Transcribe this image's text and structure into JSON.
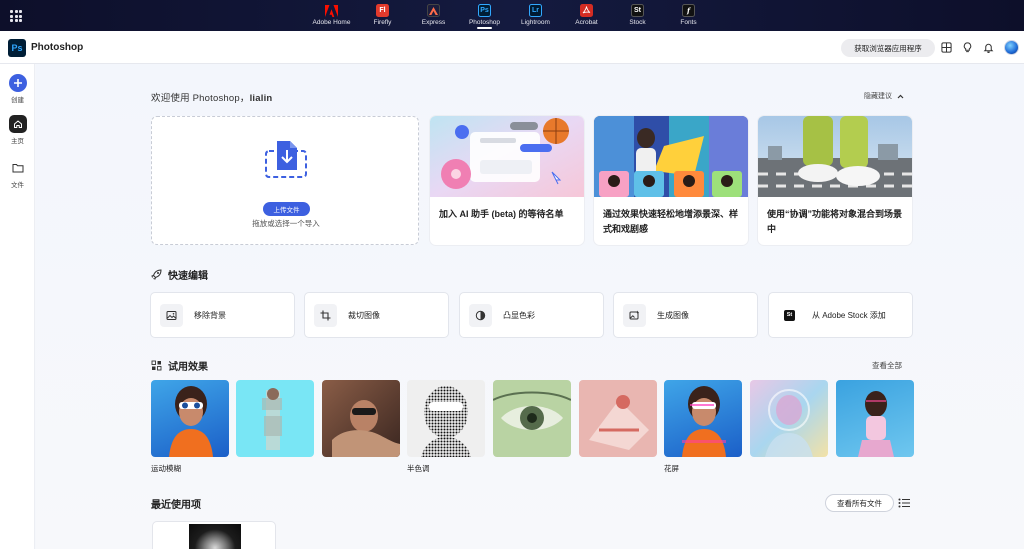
{
  "topbar": {
    "apps": [
      {
        "label": "Adobe Home",
        "logo": "A",
        "color": "#1a1a1a",
        "active": false
      },
      {
        "label": "Firefly",
        "logo": "Fl",
        "color": "#d7373f",
        "active": false
      },
      {
        "label": "Express",
        "logo": "A",
        "color": "#1b1d3a",
        "active": false
      },
      {
        "label": "Photoshop",
        "logo": "Ps",
        "color": "#001e36",
        "active": true
      },
      {
        "label": "Lightroom",
        "logo": "Lr",
        "color": "#001a33",
        "active": false
      },
      {
        "label": "Acrobat",
        "logo": "A",
        "color": "#d42c23",
        "active": false
      },
      {
        "label": "Stock",
        "logo": "St",
        "color": "#111111",
        "active": false
      },
      {
        "label": "Fonts",
        "logo": "f",
        "color": "#111111",
        "active": false
      }
    ]
  },
  "header": {
    "logo": "Ps",
    "title": "Photoshop",
    "get_app": "获取浏览器应用程序"
  },
  "rail": {
    "create": "创建",
    "home": "主页",
    "files": "文件"
  },
  "welcome": {
    "prefix": "欢迎使用 Photoshop，",
    "user": "lialin",
    "hide": "隐藏建议"
  },
  "upload": {
    "button": "上传文件",
    "hint": "拖放或选择一个导入"
  },
  "promos": [
    {
      "text": "加入 AI 助手 (beta) 的等待名单"
    },
    {
      "text": "通过效果快速轻松地增添景深、样式和戏剧感"
    },
    {
      "text": "使用“协调”功能将对象混合到场景中"
    }
  ],
  "quick_edit": {
    "title": "快速编辑",
    "items": [
      {
        "label": "移除背景",
        "icon": "image-icon"
      },
      {
        "label": "裁切图像",
        "icon": "crop-icon"
      },
      {
        "label": "凸显色彩",
        "icon": "color-pop-icon"
      },
      {
        "label": "生成图像",
        "icon": "generate-image-icon"
      },
      {
        "label": "从 Adobe Stock 添加",
        "icon": "stock-icon"
      }
    ]
  },
  "effects": {
    "title": "试用效果",
    "see_all": "查看全部",
    "labels": [
      "运动模糊",
      "",
      "",
      "半色调",
      "",
      "",
      "花屏",
      "",
      ""
    ]
  },
  "recent": {
    "title": "最近使用项",
    "view_all": "查看所有文件"
  },
  "colors": {
    "accent": "#3d60e0",
    "topbar": "#0d0f2a"
  }
}
